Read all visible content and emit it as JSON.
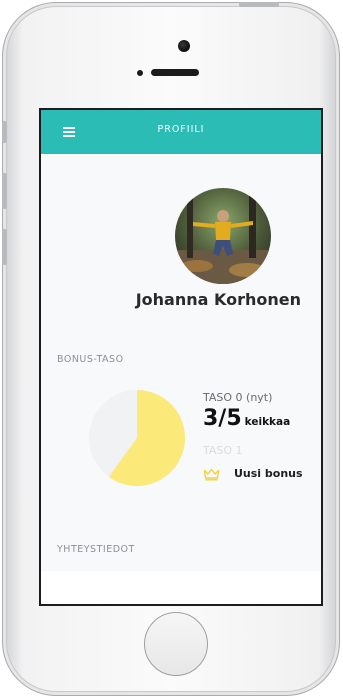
{
  "header": {
    "title": "PROFIILI",
    "menu_icon": "hamburger-menu-icon"
  },
  "profile": {
    "name": "Johanna Korhonen"
  },
  "bonus": {
    "section_label": "BONUS-TASO",
    "current_level": "TASO 0 (nyt)",
    "progress_count": "3/5",
    "progress_unit": "keikkaa",
    "progress_fraction": 0.6,
    "next_level": "TASO 1",
    "reward_label": "Uusi bonus",
    "reward_icon": "crown-icon"
  },
  "contact": {
    "section_label": "YHTEYSTIEDOT"
  },
  "colors": {
    "header": "#2bbdb5",
    "pie_fill": "#fbe97a",
    "pie_track": "#f0f2f4",
    "crown": "#f2d23a"
  }
}
